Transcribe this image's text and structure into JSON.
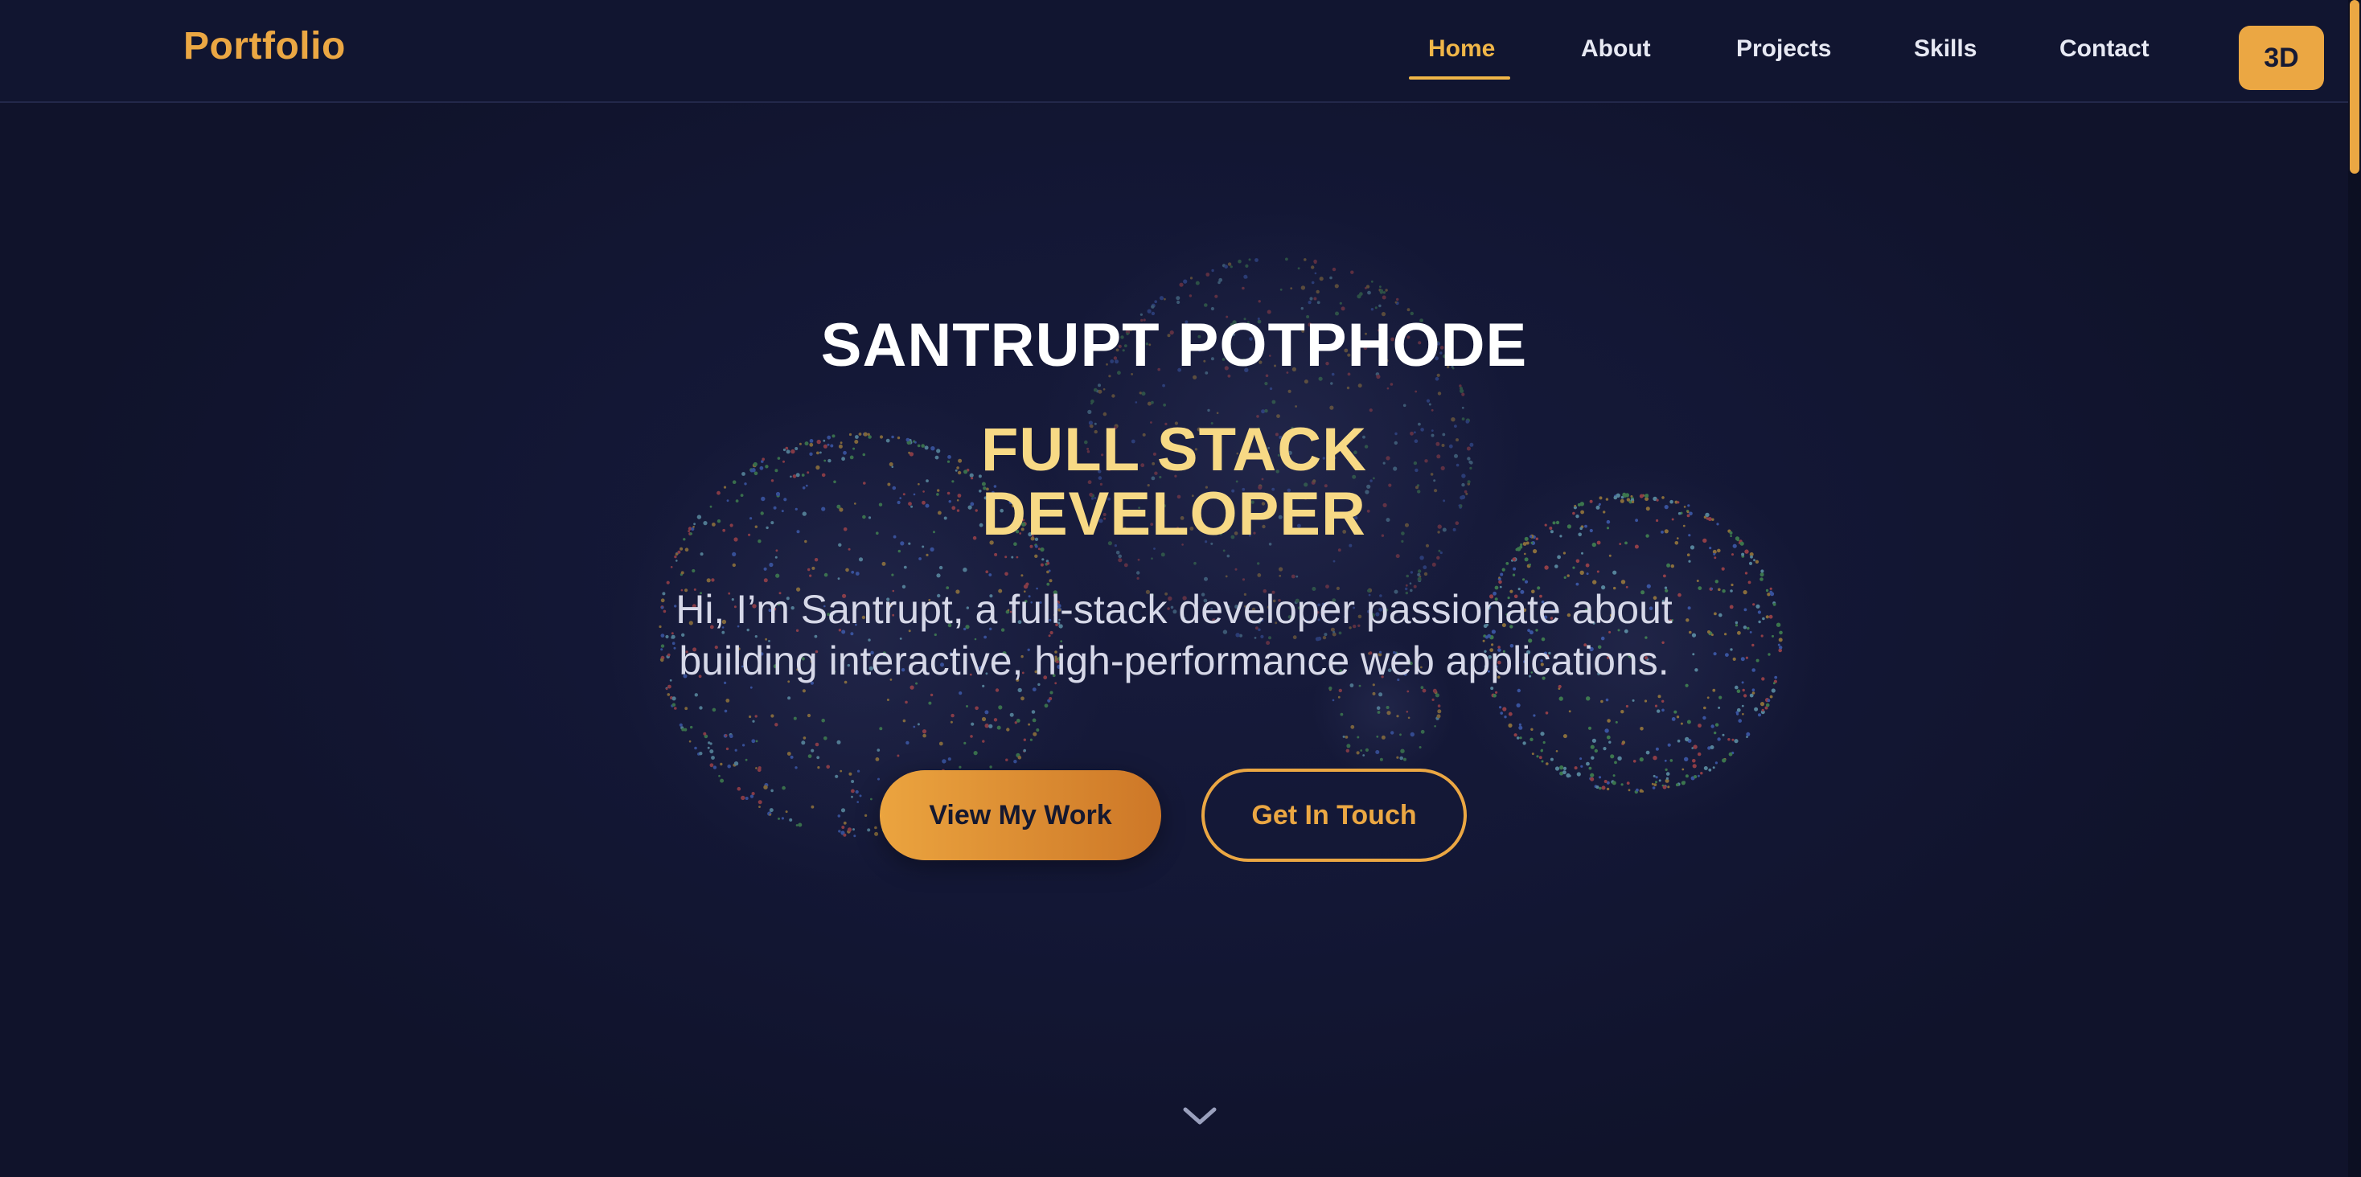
{
  "nav": {
    "brand": "Portfolio",
    "links": [
      {
        "label": "Home",
        "active": true
      },
      {
        "label": "About",
        "active": false
      },
      {
        "label": "Projects",
        "active": false
      },
      {
        "label": "Skills",
        "active": false
      },
      {
        "label": "Contact",
        "active": false
      }
    ],
    "toggle_label": "3D"
  },
  "hero": {
    "name": "SANTRUPT POTPHODE",
    "role_line1": "FULL STACK",
    "role_line2": "DEVELOPER",
    "intro": "Hi, I’m Santrupt, a full-stack developer passionate about building interactive, high-performance web applications.",
    "primary_button": "View My Work",
    "secondary_button": "Get In Touch",
    "scroll_icon": "chevron-down-icon"
  },
  "colors": {
    "background": "#121630",
    "accent": "#eba743",
    "accent_light": "#f7d985",
    "text": "#ffffff",
    "muted_text": "#d6d8e8"
  }
}
